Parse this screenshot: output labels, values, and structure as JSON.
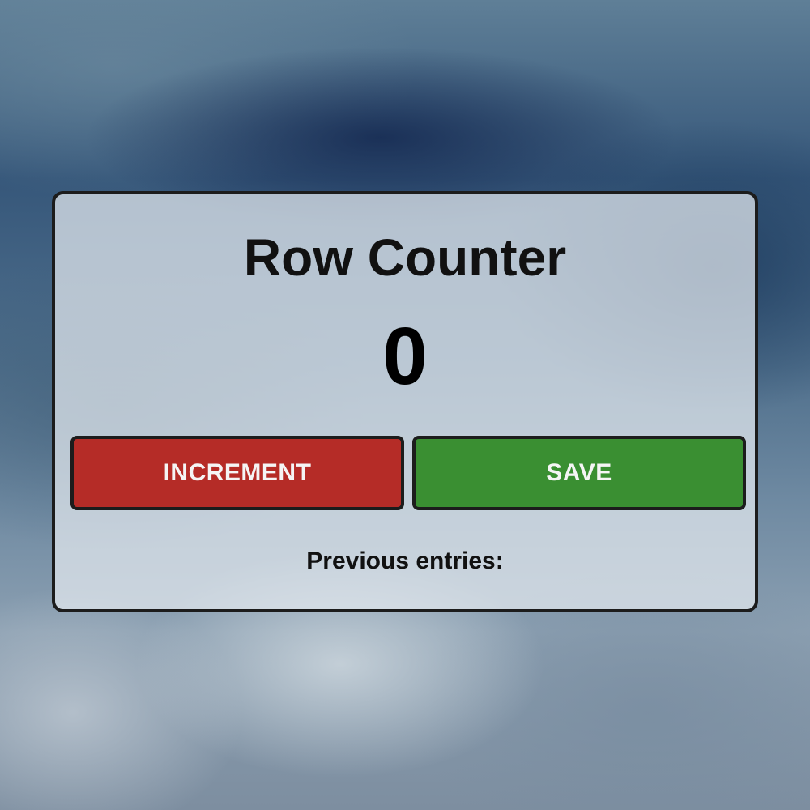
{
  "app": {
    "title": "Row Counter",
    "count": "0"
  },
  "actions": {
    "increment_label": "INCREMENT",
    "save_label": "SAVE"
  },
  "entries": {
    "label": "Previous entries:",
    "items": []
  },
  "colors": {
    "increment": "#b52c27",
    "save": "#3a8f32",
    "border": "#1c1c1c"
  }
}
